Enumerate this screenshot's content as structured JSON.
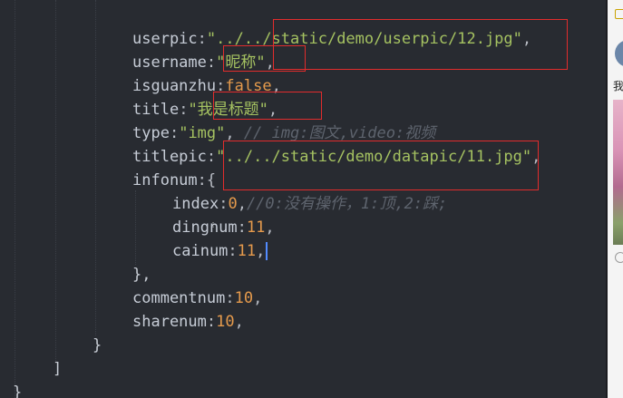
{
  "code": {
    "userpic_key": "userpic",
    "userpic_val": "\"../../static/demo/userpic/12.jpg\"",
    "username_key": "username",
    "username_val": "\"昵称\"",
    "isguanzhu_key": "isguanzhu",
    "isguanzhu_val": "false",
    "title_key": "title",
    "title_val": "\"我是标题\"",
    "type_key": "type",
    "type_val": "\"img\"",
    "type_comment": "// img:图文,video:视频",
    "titlepic_key": "titlepic",
    "titlepic_val": "\"../../static/demo/datapic/11.jpg\"",
    "infonum_key": "infonum",
    "index_key": "index",
    "index_val": "0",
    "index_comment": "//0:没有操作，1:顶,2:踩;",
    "dingnum_key": "dingnum",
    "dingnum_val": "11",
    "cainum_key": "cainum",
    "cainum_val": "11",
    "commentnum_key": "commentnum",
    "commentnum_val": "10",
    "sharenum_key": "sharenum",
    "sharenum_val": "10"
  },
  "side": {
    "text": "我"
  },
  "colors": {
    "highlight_box": "#e22c2c",
    "editor_bg": "#282b31",
    "string": "#a5c261",
    "number": "#e59a4c"
  }
}
